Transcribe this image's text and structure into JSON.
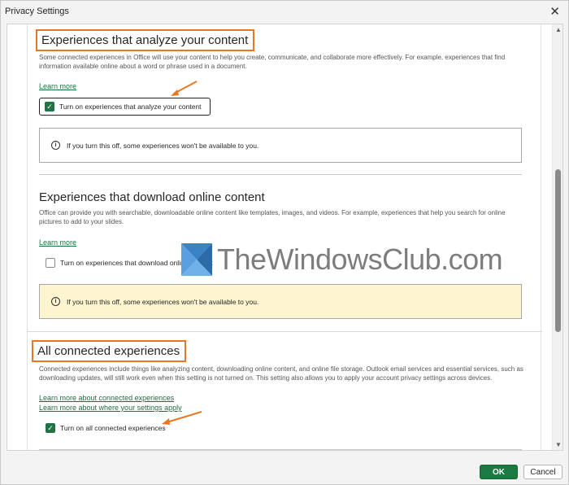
{
  "window": {
    "title": "Privacy Settings"
  },
  "sections": {
    "analyze": {
      "title": "Experiences that analyze your content",
      "description": "Some connected experiences in Office will use your content to help you create, communicate, and collaborate more effectively. For example, experiences that find information available online about a word or phrase used in a document.",
      "learn_more": "Learn more",
      "checkbox_label": "Turn on experiences that analyze your content",
      "checked": true,
      "info_text": "If you turn this off, some experiences won't be available to you."
    },
    "download": {
      "title": "Experiences that download online content",
      "description": "Office can provide you with searchable, downloadable online content like templates, images, and videos. For example, experiences that help you search for online pictures to add to your slides.",
      "learn_more": "Learn more",
      "checkbox_label": "Turn on experiences that download online content",
      "checked": false,
      "info_text": "If you turn this off, some experiences won't be available to you."
    },
    "all": {
      "title": "All connected experiences",
      "description": "Connected experiences include things like analyzing content, downloading online content, and online file storage. Outlook email services and essential services, such as downloading updates, will still work even when this setting is not turned on. This setting also allows you to apply your account privacy settings across devices.",
      "learn_more_1": "Learn more about connected experiences",
      "learn_more_2": "Learn more about where your settings apply",
      "checkbox_label": "Turn on all connected experiences",
      "checked": true
    }
  },
  "watermark": {
    "text": "TheWindowsClub.com"
  },
  "buttons": {
    "ok": "OK",
    "cancel": "Cancel"
  },
  "colors": {
    "accent": "#217346",
    "highlight_box": "#e87722",
    "warning_bg": "#fcf5cf"
  }
}
